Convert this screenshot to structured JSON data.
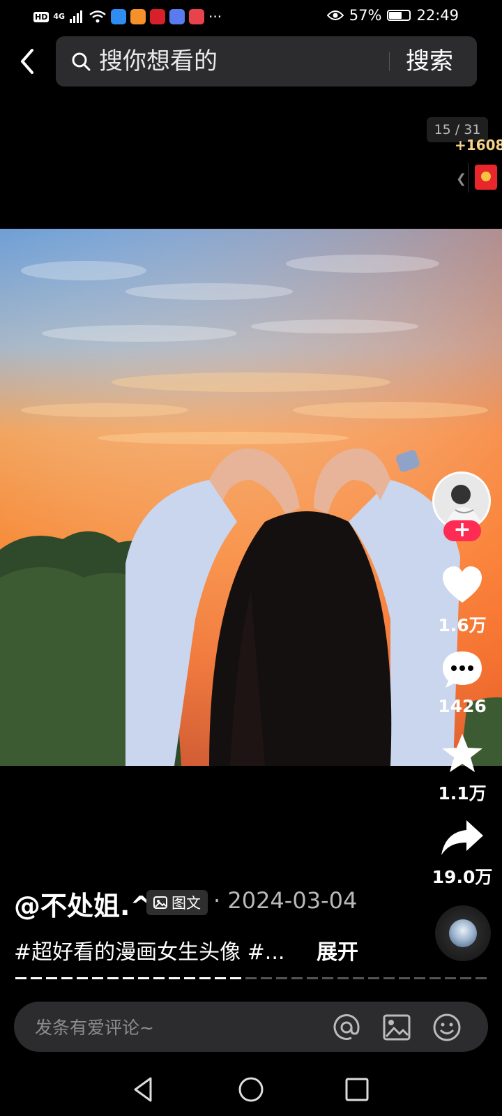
{
  "status_bar": {
    "hd_badge": "HD",
    "network": "4G",
    "battery_text": "57%",
    "battery_level": 0.57,
    "time": "22:49",
    "more": "···"
  },
  "header": {
    "search_placeholder": "搜你想看的",
    "search_button": "搜索"
  },
  "page_indicator": "15 / 31",
  "reward": {
    "count": "+1608"
  },
  "actions": {
    "likes": "1.6万",
    "comments": "1426",
    "favorites": "1.1万",
    "shares": "19.0万"
  },
  "post": {
    "author": "@不处姐.^",
    "type_label": "图文",
    "date": "· 2024-03-04",
    "caption": "#超好看的漫画女生头像 #...",
    "expand": "展开",
    "progress": {
      "total": 31,
      "current": 15
    }
  },
  "comment_bar": {
    "placeholder": "发条有爱评论~"
  },
  "colors": {
    "accent": "#fe2c55",
    "reward_gold": "#f6d28b",
    "surface": "#2c2c2e"
  }
}
